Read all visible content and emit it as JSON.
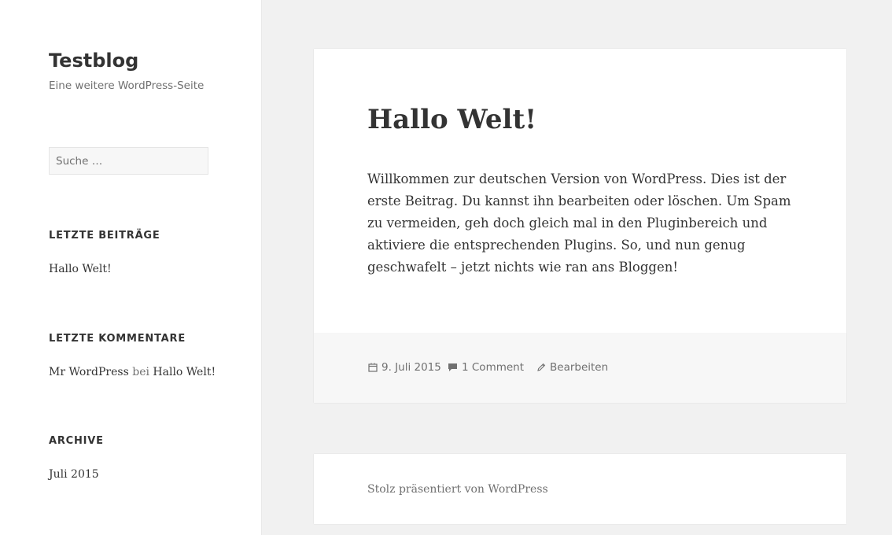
{
  "site": {
    "title": "Testblog",
    "tagline": "Eine weitere WordPress-Seite"
  },
  "search": {
    "placeholder": "Suche …"
  },
  "widgets": {
    "recent_posts": {
      "title": "LETZTE BEITRÄGE",
      "items": [
        "Hallo Welt!"
      ]
    },
    "recent_comments": {
      "title": "LETZTE KOMMENTARE",
      "author": "Mr WordPress",
      "separator": "bei",
      "post": "Hallo Welt!"
    },
    "archive": {
      "title": "ARCHIVE",
      "items": [
        "Juli 2015"
      ]
    }
  },
  "post": {
    "title": "Hallo Welt!",
    "content": "Willkommen zur deutschen Version von WordPress. Dies ist der erste Beitrag. Du kannst ihn bearbeiten oder löschen. Um Spam zu vermeiden, geh doch gleich mal in den Pluginbereich und aktiviere die entsprechenden Plugins. So, und nun genug geschwafelt – jetzt nichts wie ran ans Bloggen!",
    "meta": {
      "date": "9. Juli 2015",
      "comments": "1 Comment",
      "edit": "Bearbeiten"
    }
  },
  "footer": {
    "credit": "Stolz präsentiert von WordPress"
  },
  "icons": {
    "date": "calendar-icon",
    "comments": "comment-bubble-icon",
    "edit": "pencil-icon"
  },
  "colors": {
    "background": "#f1f1f1",
    "text": "#333333",
    "muted": "#707070",
    "footer_bar": "#f7f7f7"
  }
}
